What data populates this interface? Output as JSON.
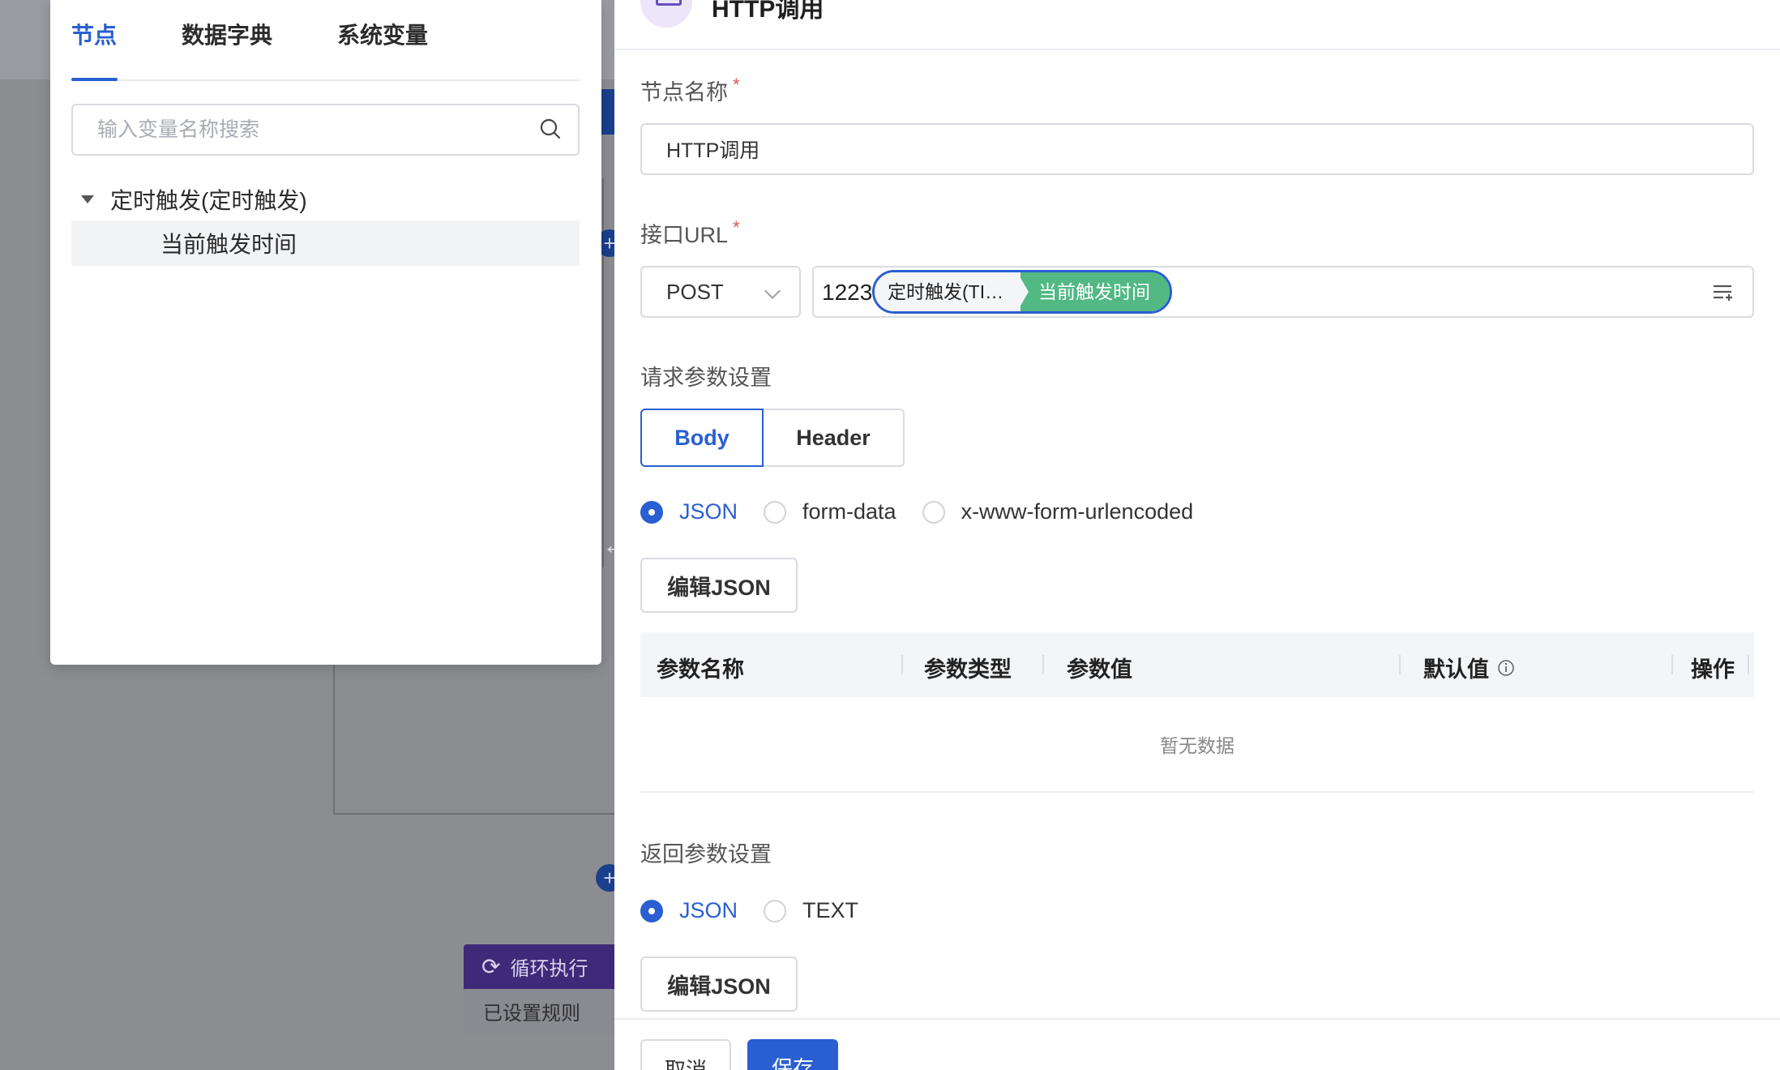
{
  "popover": {
    "tabs": [
      "节点",
      "数据字典",
      "系统变量"
    ],
    "search_placeholder": "输入变量名称搜索",
    "tree": {
      "root": "定时触发(定时触发)",
      "leaf": "当前触发时间"
    }
  },
  "background": {
    "loop_node_title": "循环执行",
    "loop_node_status": "已设置规则"
  },
  "drawer": {
    "title": "HTTP调用",
    "node_name_label": "节点名称",
    "node_name_value": "HTTP调用",
    "url_label": "接口URL",
    "method": "POST",
    "url_prefix": "1223",
    "url_var_source": "定时触发(TI…",
    "url_var_field": "当前触发时间",
    "request_label": "请求参数设置",
    "request_tabs": [
      "Body",
      "Header"
    ],
    "body_types": [
      "JSON",
      "form-data",
      "x-www-form-urlencoded"
    ],
    "edit_json_label": "编辑JSON",
    "table_headers": [
      "参数名称",
      "参数类型",
      "参数值",
      "默认值",
      "操作"
    ],
    "table_empty": "暂无数据",
    "response_label": "返回参数设置",
    "response_types": [
      "JSON",
      "TEXT"
    ],
    "response_edit_json_label": "编辑JSON",
    "cancel_label": "取消",
    "save_label": "保存"
  },
  "colors": {
    "primary": "#2a5fd1",
    "variable_tag": "#52b884",
    "loop_node": "#3f2a79",
    "required": "#e05353"
  }
}
